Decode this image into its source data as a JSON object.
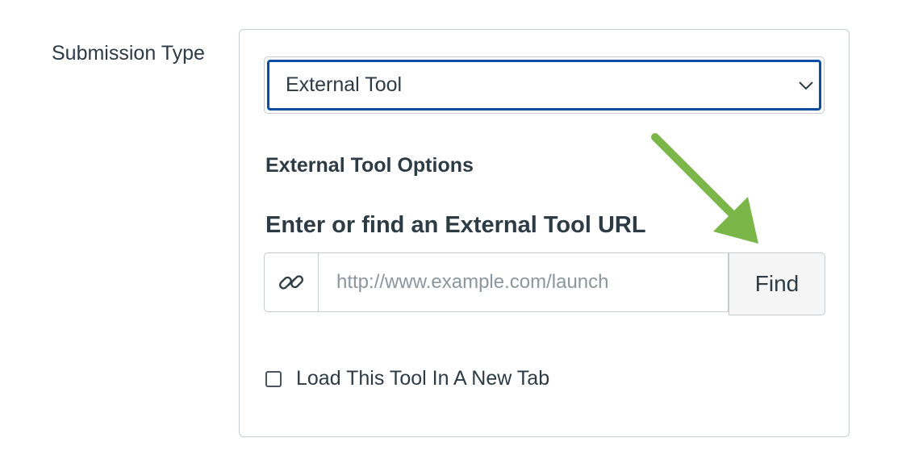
{
  "form": {
    "submission_type_label": "Submission Type",
    "submission_type_value": "External Tool"
  },
  "external_tool": {
    "section_heading": "External Tool Options",
    "url_heading": "Enter or find an External Tool URL",
    "url_placeholder": "http://www.example.com/launch",
    "url_value": "",
    "find_label": "Find",
    "new_tab_label": "Load This Tool In A New Tab",
    "new_tab_checked": false
  },
  "icons": {
    "link": "link-icon",
    "chevron": "chevron-down-icon",
    "arrow": "annotation-arrow"
  },
  "colors": {
    "focus_border": "#0b4da1",
    "annotation_arrow": "#7ab648",
    "text": "#2d3b45",
    "placeholder": "#8b969e",
    "border": "#c7cdd1"
  }
}
